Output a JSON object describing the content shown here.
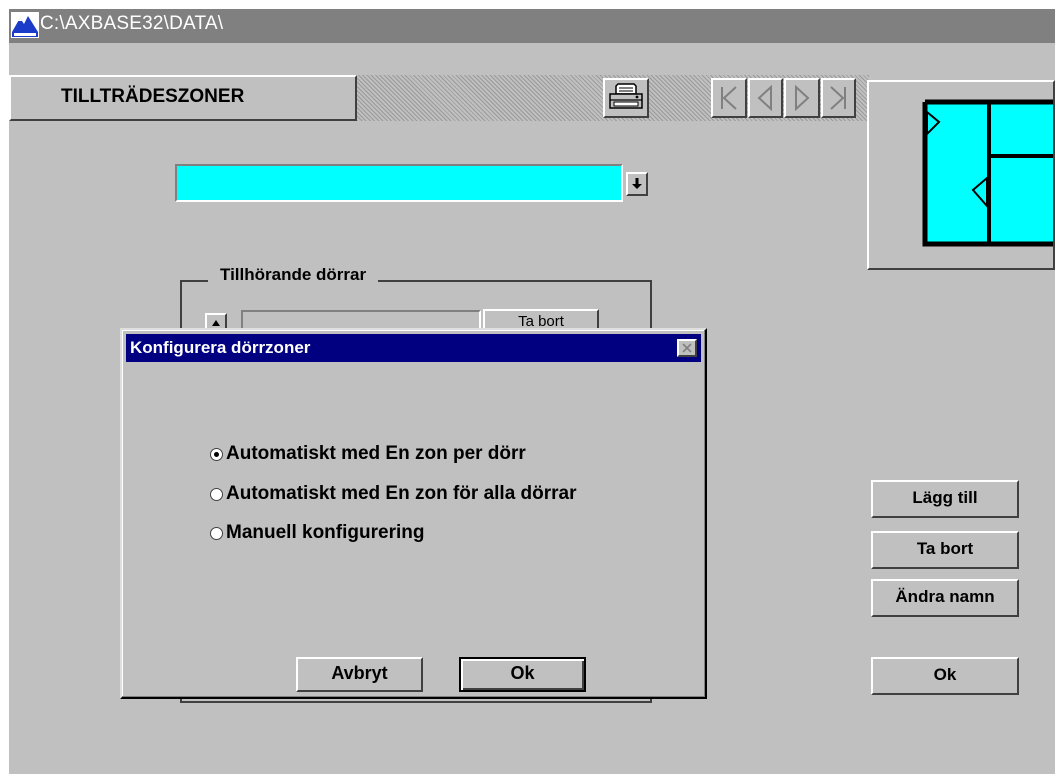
{
  "window": {
    "title": "C:\\AXBASE32\\DATA\\"
  },
  "tab": {
    "label": "TILLTRÄDESZONER"
  },
  "toolbar": {
    "print_icon": "printer-icon",
    "nav": [
      "first-record-icon",
      "previous-record-icon",
      "next-record-icon",
      "last-record-icon"
    ]
  },
  "combo": {
    "value": "",
    "color": "#00ffff"
  },
  "group": {
    "legend": "Tillhörande dörrar",
    "remove_label": "Ta bort"
  },
  "side_buttons": {
    "add": "Lägg till",
    "remove": "Ta bort",
    "rename": "Ändra namn",
    "ok": "Ok"
  },
  "dialog": {
    "title": "Konfigurera dörrzoner",
    "options": [
      "Automatiskt med En zon per dörr",
      "Automatiskt med En zon för alla dörrar",
      "Manuell konfigurering"
    ],
    "selected_index": 0,
    "cancel": "Avbryt",
    "ok": "Ok"
  },
  "colors": {
    "titlebar": "#808080",
    "dialog_title": "#000080",
    "accent": "#00ffff"
  }
}
